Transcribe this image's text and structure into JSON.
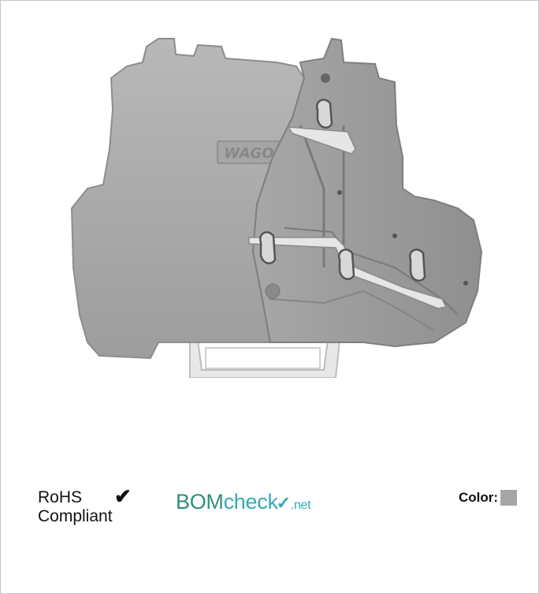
{
  "product": {
    "logo_text": "WAGO",
    "color_hex": "#a6a6a6"
  },
  "rohs": {
    "line1": "RoHS",
    "line2": "Compliant",
    "check": "✔"
  },
  "bomcheck": {
    "part1": "BOM",
    "part2": "check",
    "tick": "✓",
    "part3": ".net"
  },
  "color": {
    "label": "Color:",
    "swatch": "#a6a6a6"
  }
}
